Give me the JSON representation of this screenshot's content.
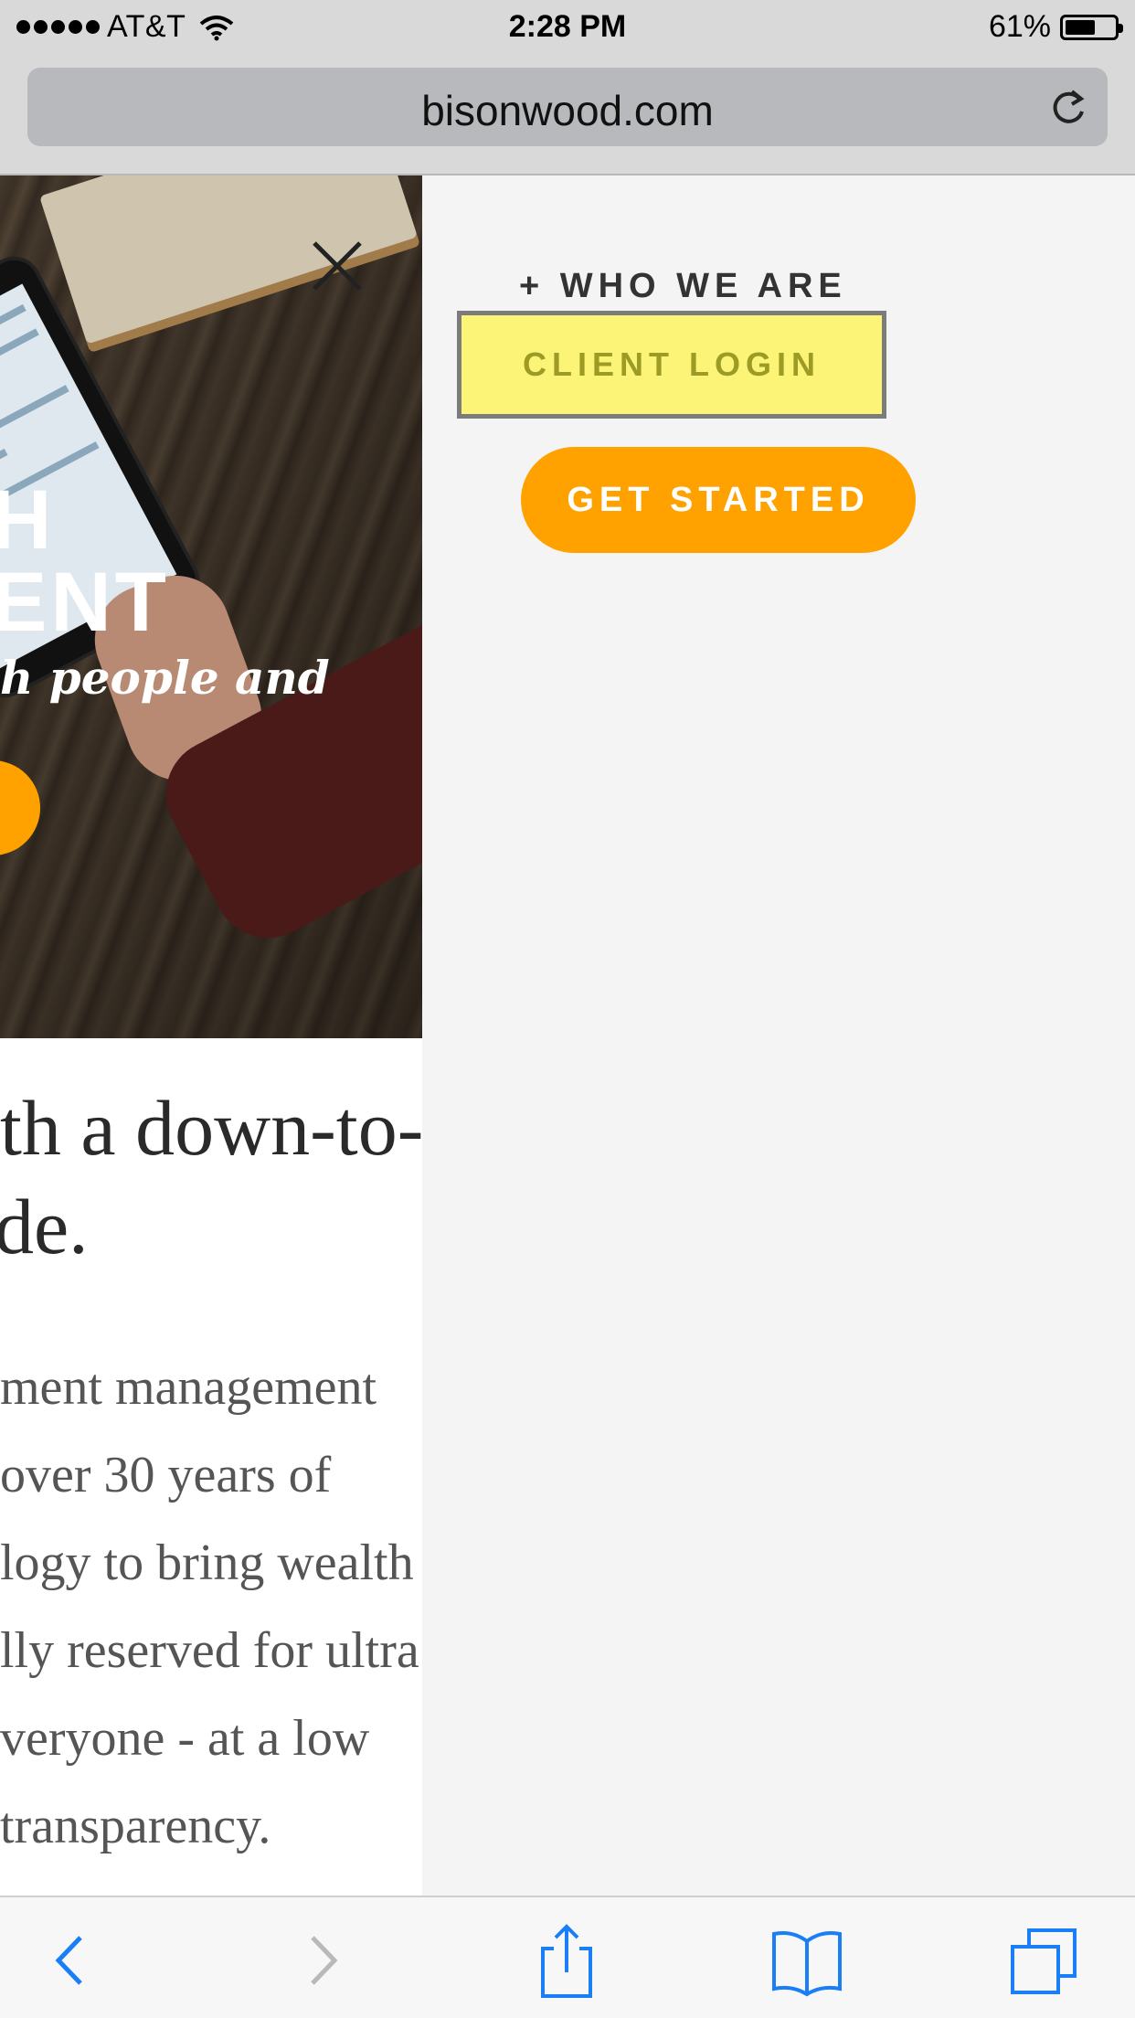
{
  "status_bar": {
    "carrier": "AT&T",
    "time": "2:28 PM",
    "battery_percent_text": "61%",
    "battery_level": 0.61
  },
  "browser": {
    "url": "bisonwood.com"
  },
  "hero": {
    "headline_line1": "H",
    "headline_line2": "ENT",
    "tagline": "h people and"
  },
  "content": {
    "heading_line1": "th a down-to-",
    "heading_line2": "de.",
    "paragraph_lines": [
      "ment management",
      " over 30 years of",
      "logy to bring wealth",
      "lly reserved for ultra",
      "veryone - at a low",
      "transparency."
    ]
  },
  "menu": {
    "who_we_are": "+ WHO WE ARE",
    "client_login": "CLIENT LOGIN",
    "get_started": "GET STARTED"
  },
  "colors": {
    "accent_orange": "#ffa200",
    "login_yellow": "#fbf476",
    "ios_blue": "#1a7ff6"
  }
}
